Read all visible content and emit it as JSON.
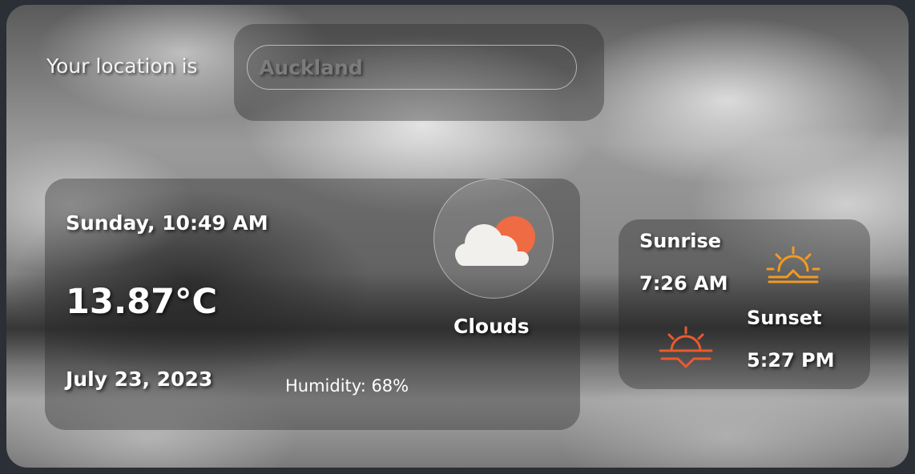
{
  "location": {
    "label": "Your location is",
    "value": "Auckland"
  },
  "weather": {
    "day_time": "Sunday, 10:49 AM",
    "temperature": "13.87°C",
    "date": "July 23, 2023",
    "humidity": "Humidity: 68%",
    "condition": "Clouds",
    "condition_icon": "clouds-sun-icon"
  },
  "sun": {
    "sunrise_label": "Sunrise",
    "sunrise_time": "7:26 AM",
    "sunrise_icon": "sunrise-icon",
    "sunset_label": "Sunset",
    "sunset_time": "5:27 PM",
    "sunset_icon": "sunset-icon"
  },
  "colors": {
    "sunrise": "#f39a22",
    "sunset": "#ea5a30",
    "sun_orb": "#ee6b43",
    "cloud": "#f2f0ed"
  }
}
